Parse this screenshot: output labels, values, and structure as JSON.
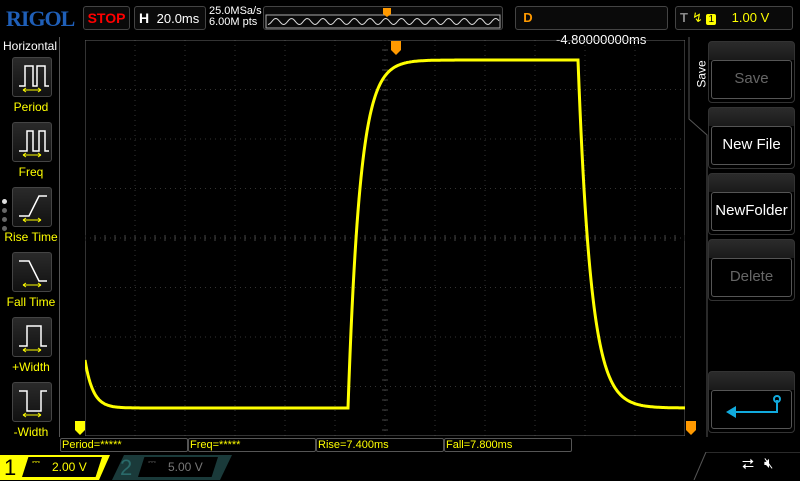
{
  "brand": "RIGOL",
  "run_state": "STOP",
  "horizontal": {
    "label": "H",
    "timebase": "20.0ms",
    "sample_rate": "25.0MSa/s",
    "memory_depth": "6.00M pts"
  },
  "delay": {
    "label": "D",
    "value": "-4.80000000ms"
  },
  "trigger": {
    "label": "T",
    "edge": "rising-edge-icon",
    "source": "1",
    "level": "1.00 V"
  },
  "left_menu": {
    "title": "Horizontal",
    "items": [
      {
        "label": "Period",
        "icon": "period-icon"
      },
      {
        "label": "Freq",
        "icon": "freq-icon"
      },
      {
        "label": "Rise Time",
        "icon": "rise-time-icon"
      },
      {
        "label": "Fall Time",
        "icon": "fall-time-icon"
      },
      {
        "label": "+Width",
        "icon": "pos-width-icon"
      },
      {
        "label": "-Width",
        "icon": "neg-width-icon"
      }
    ]
  },
  "right_menu": {
    "title": "Save",
    "buttons": [
      {
        "label": "Save",
        "enabled": false
      },
      {
        "label": "New File",
        "enabled": true
      },
      {
        "label": "NewFolder",
        "enabled": true
      },
      {
        "label": "Delete",
        "enabled": false
      }
    ],
    "back_icon": "return-arrow-icon"
  },
  "measurements": [
    "Period=*****",
    "Freq=*****",
    "Rise=7.400ms",
    "Fall=7.800ms"
  ],
  "channels": [
    {
      "num": "1",
      "coupling": "DC",
      "scale": "2.00 V",
      "color": "#ffff00",
      "active": true
    },
    {
      "num": "2",
      "coupling": "DC",
      "scale": "5.00 V",
      "color": "#2a6a6a",
      "active": false
    }
  ],
  "status_icons": [
    "usb-icon",
    "sound-muted-icon"
  ],
  "colors": {
    "ch1": "#ffff00",
    "trigger": "#ff9900",
    "brand": "#1f5fb8",
    "stop": "#ff0000"
  }
}
